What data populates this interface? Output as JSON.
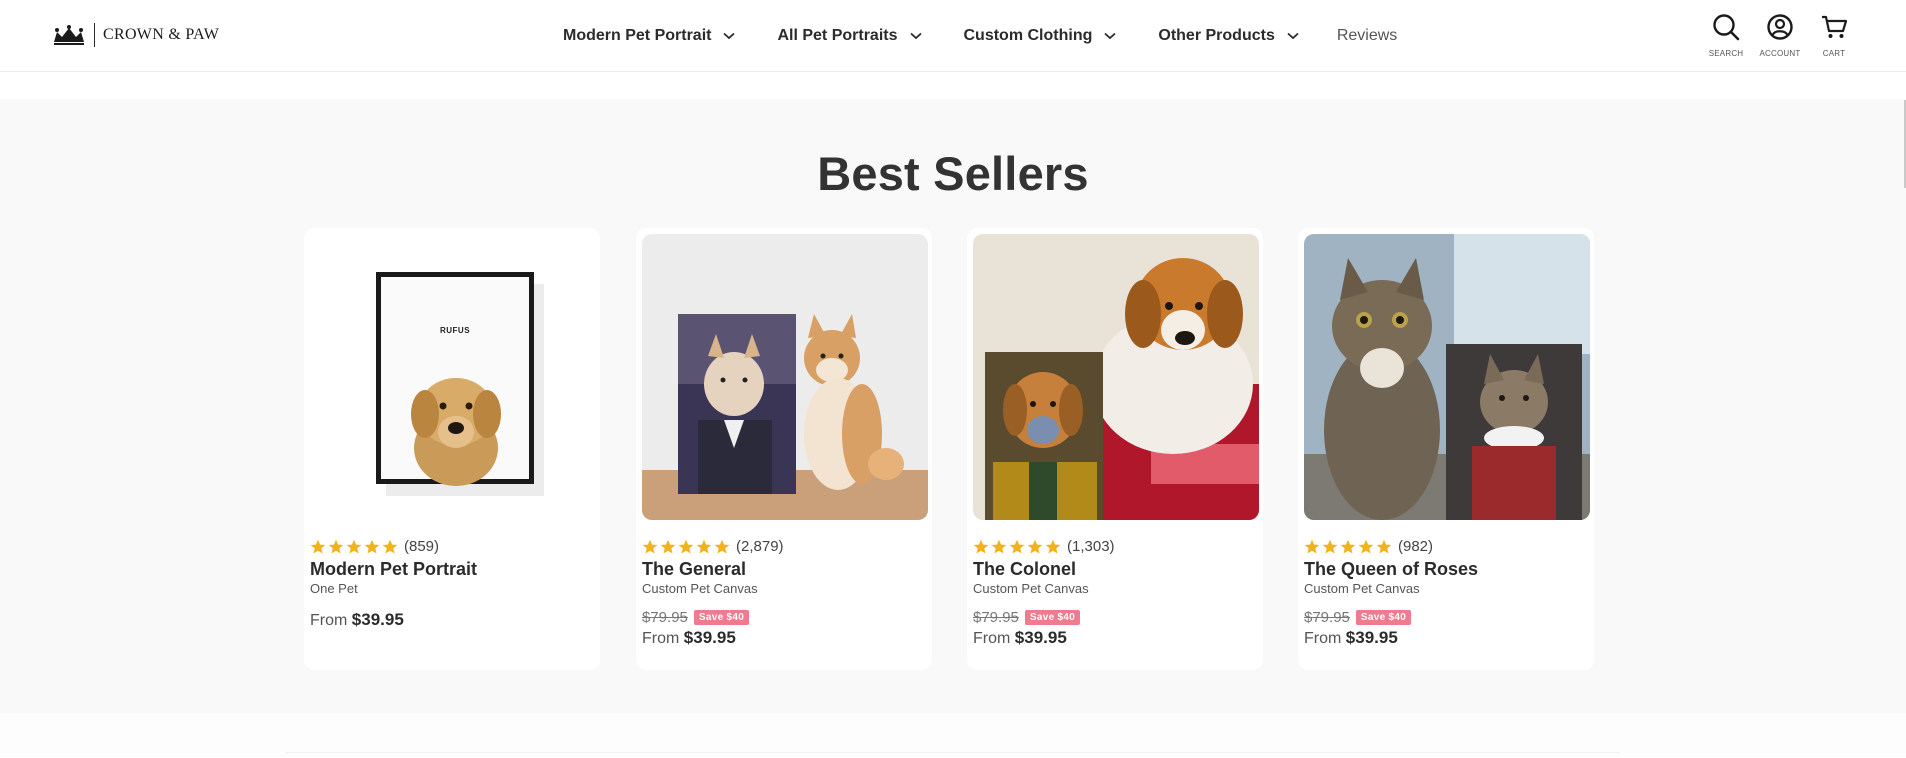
{
  "header": {
    "logo_text": "CROWN & PAW",
    "nav": [
      {
        "label": "Modern Pet Portrait",
        "has_dropdown": true
      },
      {
        "label": "All Pet Portraits",
        "has_dropdown": true
      },
      {
        "label": "Custom Clothing",
        "has_dropdown": true
      },
      {
        "label": "Other Products",
        "has_dropdown": true
      },
      {
        "label": "Reviews",
        "has_dropdown": false
      }
    ],
    "icons": [
      {
        "label": "SEARCH",
        "icon": "search-icon"
      },
      {
        "label": "ACCOUNT",
        "icon": "account-icon"
      },
      {
        "label": "CART",
        "icon": "cart-icon"
      }
    ]
  },
  "section": {
    "title": "Best Sellers"
  },
  "products": [
    {
      "name": "Modern Pet Portrait",
      "subtitle": "One Pet",
      "rating_stars": 5,
      "review_count": "(859)",
      "old_price": "",
      "save_badge": "",
      "from_label": "From",
      "price": "$39.95",
      "frame_label": "RUFUS"
    },
    {
      "name": "The General",
      "subtitle": "Custom Pet Canvas",
      "rating_stars": 5,
      "review_count": "(2,879)",
      "old_price": "$79.95",
      "save_badge": "Save $40",
      "from_label": "From",
      "price": "$39.95"
    },
    {
      "name": "The Colonel",
      "subtitle": "Custom Pet Canvas",
      "rating_stars": 5,
      "review_count": "(1,303)",
      "old_price": "$79.95",
      "save_badge": "Save $40",
      "from_label": "From",
      "price": "$39.95"
    },
    {
      "name": "The Queen of Roses",
      "subtitle": "Custom Pet Canvas",
      "rating_stars": 5,
      "review_count": "(982)",
      "old_price": "$79.95",
      "save_badge": "Save $40",
      "from_label": "From",
      "price": "$39.95"
    }
  ],
  "colors": {
    "star": "#f2b21b",
    "save_badge": "#f07a8e",
    "section_bg": "#f9f9f9",
    "text_dark": "#2b2b2b"
  }
}
